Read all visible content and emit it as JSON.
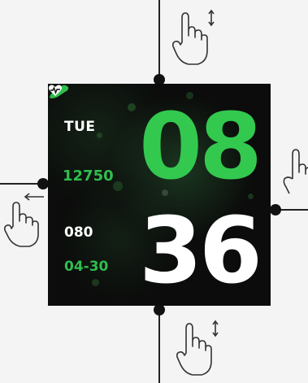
{
  "watch": {
    "day": "TUE",
    "steps": "12750",
    "heart_rate": "080",
    "date": "04-30",
    "hours": "08",
    "minutes": "36"
  },
  "colors": {
    "accent_green": "#2fbd4e",
    "time_green": "#33c94f",
    "face_background": "#0b0c0b",
    "line": "#222222"
  },
  "icons": {
    "steps": "shoe-icon",
    "heart": "heart-pulse-icon",
    "gesture": "hand-pointer-icon",
    "swipe_vertical": "up-down-arrow-icon",
    "swipe_horizontal": "left-right-arrow-icon"
  }
}
